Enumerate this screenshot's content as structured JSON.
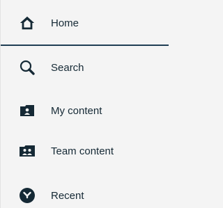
{
  "nav": {
    "items": [
      {
        "label": "Home",
        "icon": "home-icon"
      },
      {
        "label": "Search",
        "icon": "search-icon"
      },
      {
        "label": "My content",
        "icon": "folder-user-icon"
      },
      {
        "label": "Team content",
        "icon": "folder-team-icon"
      },
      {
        "label": "Recent",
        "icon": "clock-icon"
      }
    ]
  },
  "colors": {
    "icon": "#152935",
    "text": "#152935",
    "background": "#f4f4f4",
    "divider": "#1f3e54"
  }
}
